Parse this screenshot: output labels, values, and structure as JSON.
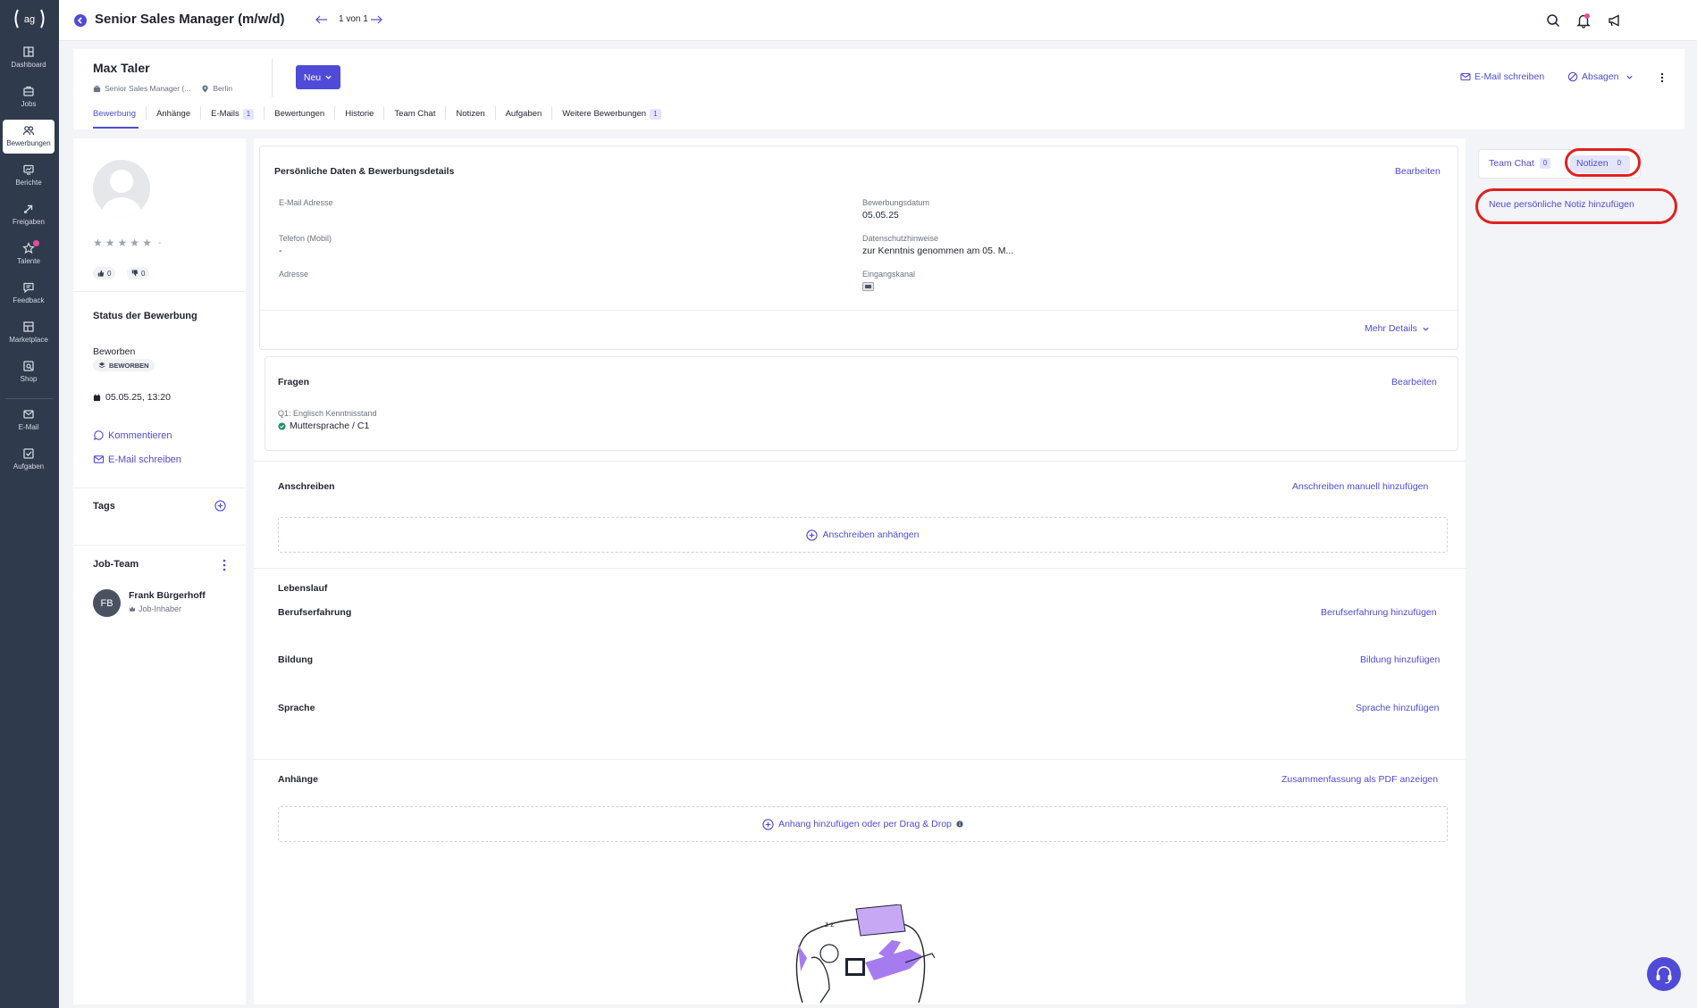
{
  "sidebar": {
    "items": [
      {
        "label": "Dashboard",
        "icon": "dashboard-icon"
      },
      {
        "label": "Jobs",
        "icon": "briefcase-icon"
      },
      {
        "label": "Bewerbungen",
        "icon": "users-icon",
        "active": true
      },
      {
        "label": "Berichte",
        "icon": "report-icon"
      },
      {
        "label": "Freigaben",
        "icon": "share-icon"
      },
      {
        "label": "Talente",
        "icon": "star-icon"
      },
      {
        "label": "Feedback",
        "icon": "feedback-icon"
      },
      {
        "label": "Marketplace",
        "icon": "marketplace-icon"
      },
      {
        "label": "Shop",
        "icon": "shop-icon"
      },
      {
        "label": "E-Mail",
        "icon": "mail-icon"
      },
      {
        "label": "Aufgaben",
        "icon": "tasks-icon"
      }
    ]
  },
  "topbar": {
    "title": "Senior Sales Manager (m/w/d)",
    "pager": "1 von 1"
  },
  "header": {
    "name": "Max Taler",
    "job": "Senior Sales Manager (...",
    "location": "Berlin",
    "new_button": "Neu",
    "email_action": "E-Mail schreiben",
    "reject_action": "Absagen",
    "tabs": [
      {
        "label": "Bewerbung",
        "active": true
      },
      {
        "label": "Anhänge"
      },
      {
        "label": "E-Mails",
        "count": "1"
      },
      {
        "label": "Bewertungen"
      },
      {
        "label": "Historie"
      },
      {
        "label": "Team Chat"
      },
      {
        "label": "Notizen"
      },
      {
        "label": "Aufgaben"
      },
      {
        "label": "Weitere Bewerbungen",
        "count": "1"
      }
    ]
  },
  "left": {
    "rating_dash": "-",
    "thumbs_up": "0",
    "thumbs_down": "0",
    "status_title": "Status der Bewerbung",
    "status_value": "Beworben",
    "status_badge": "BEWORBEN",
    "status_date": "05.05.25, 13:20",
    "comment_link": "Kommentieren",
    "email_link": "E-Mail schreiben",
    "tags_title": "Tags",
    "team_title": "Job-Team",
    "member_initials": "FB",
    "member_name": "Frank Bürgerhoff",
    "member_role": "Job-Inhaber"
  },
  "personal": {
    "title": "Persönliche Daten & Bewerbungsdetails",
    "edit": "Bearbeiten",
    "email_label": "E-Mail Adresse",
    "phone_label": "Telefon (Mobil)",
    "phone_value": "-",
    "address_label": "Adresse",
    "date_label": "Bewerbungsdatum",
    "date_value": "05.05.25",
    "privacy_label": "Datenschutzhinweise",
    "privacy_value": "zur Kenntnis genommen am 05. M...",
    "channel_label": "Eingangskanal",
    "more": "Mehr Details"
  },
  "questions": {
    "title": "Fragen",
    "edit": "Bearbeiten",
    "q1_label": "Q1: Englisch Kenntnisstand",
    "q1_value": "Muttersprache / C1"
  },
  "cover": {
    "title": "Anschreiben",
    "add_manual": "Anschreiben manuell hinzufügen",
    "attach": "Anschreiben anhängen"
  },
  "cv": {
    "title": "Lebenslauf",
    "experience": "Berufserfahrung",
    "experience_add": "Berufserfahrung hinzufügen",
    "education": "Bildung",
    "education_add": "Bildung hinzufügen",
    "language": "Sprache",
    "language_add": "Sprache hinzufügen"
  },
  "attachments": {
    "title": "Anhänge",
    "pdf": "Zusammenfassung als PDF anzeigen",
    "add": "Anhang hinzufügen oder per Drag & Drop"
  },
  "right": {
    "tab_chat": "Team Chat",
    "tab_chat_count": "0",
    "tab_notes": "Notizen",
    "tab_notes_count": "0",
    "new_note": "Neue persönliche Notiz hinzufügen"
  },
  "colors": {
    "brand": "#4f4bd8",
    "sidebar": "#2f3a4d",
    "highlight": "#e02020",
    "illustration": "#a77bf0"
  }
}
